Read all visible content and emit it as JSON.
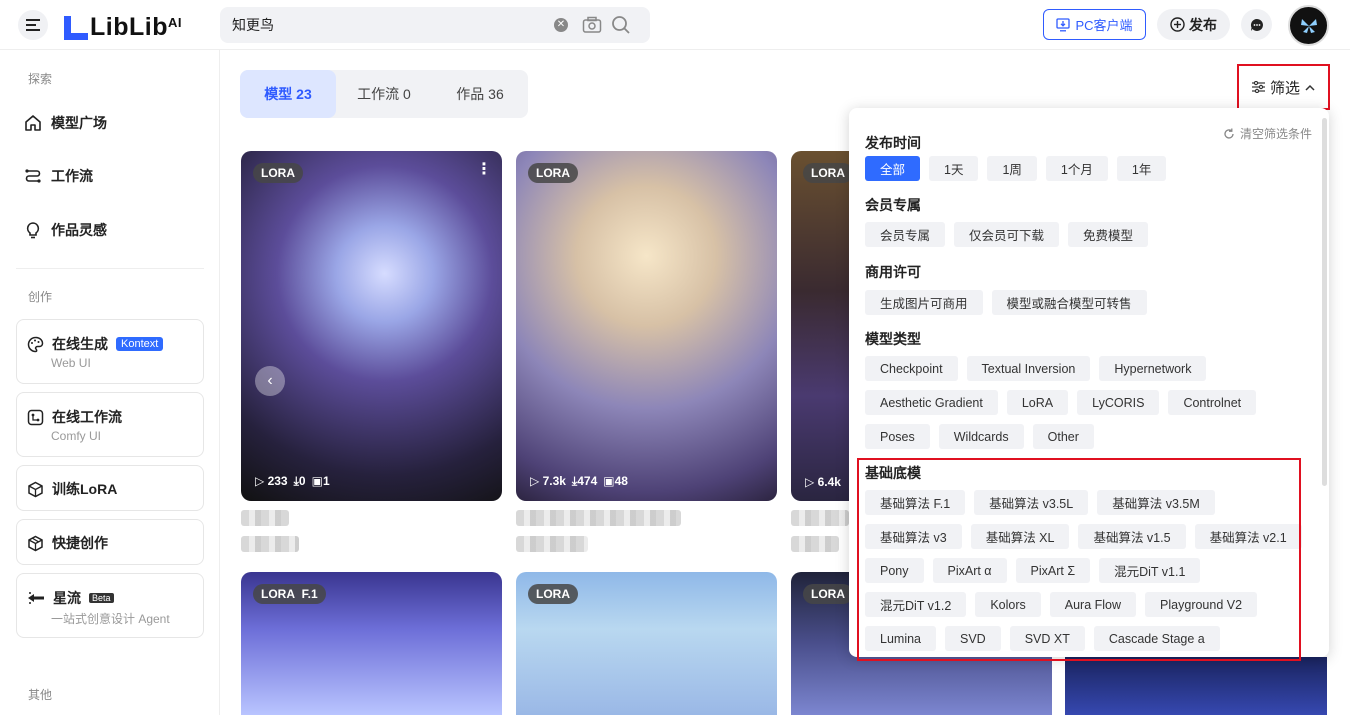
{
  "header": {
    "logo_text": "LibLib",
    "logo_suffix": "AI",
    "search_value": "知更鸟",
    "pc_client": "PC客户端",
    "publish": "发布"
  },
  "sidebar": {
    "explore_label": "探索",
    "explore_items": [
      "模型广场",
      "工作流",
      "作品灵感"
    ],
    "create_label": "创作",
    "online_gen": "在线生成",
    "online_gen_tag": "Kontext",
    "online_gen_sub": "Web UI",
    "online_workflow": "在线工作流",
    "online_workflow_sub": "Comfy UI",
    "train_lora": "训练LoRA",
    "quick_create": "快捷创作",
    "xingliu": "星流",
    "xingliu_tag": "Beta",
    "xingliu_sub": "一站式创意设计 Agent",
    "other_label": "其他"
  },
  "tabs": [
    "模型 23",
    "工作流 0",
    "作品 36"
  ],
  "filter_button": "筛选",
  "cards": [
    {
      "badge": "LORA",
      "plays": "233",
      "downloads": "0",
      "images": "1"
    },
    {
      "badge": "LORA",
      "plays": "7.3k",
      "downloads": "474",
      "images": "48"
    },
    {
      "badge": "LORA",
      "plays": "6.4k"
    },
    {
      "badge": "LORA",
      "badge2": "F.1"
    },
    {
      "badge": "LORA"
    },
    {
      "badge": "LORA"
    }
  ],
  "filter_panel": {
    "clear": "清空筛选条件",
    "sections": [
      {
        "title": "发布时间",
        "rows": [
          [
            "全部",
            "1天",
            "1周",
            "1个月",
            "1年"
          ]
        ]
      },
      {
        "title": "会员专属",
        "rows": [
          [
            "会员专属",
            "仅会员可下载",
            "免费模型"
          ]
        ]
      },
      {
        "title": "商用许可",
        "rows": [
          [
            "生成图片可商用",
            "模型或融合模型可转售"
          ]
        ]
      },
      {
        "title": "模型类型",
        "rows": [
          [
            "Checkpoint",
            "Textual Inversion",
            "Hypernetwork"
          ],
          [
            "Aesthetic Gradient",
            "LoRA",
            "LyCORIS",
            "Controlnet"
          ],
          [
            "Poses",
            "Wildcards",
            "Other"
          ]
        ]
      },
      {
        "title": "基础底模",
        "rows": [
          [
            "基础算法 F.1",
            "基础算法 v3.5L",
            "基础算法 v3.5M"
          ],
          [
            "基础算法 v3",
            "基础算法 XL",
            "基础算法 v1.5",
            "基础算法 v2.1"
          ],
          [
            "Pony",
            "PixArt α",
            "PixArt Σ",
            "混元DiT v1.1"
          ],
          [
            "混元DiT v1.2",
            "Kolors",
            "Aura Flow",
            "Playground V2"
          ],
          [
            "Lumina",
            "SVD",
            "SVD XT",
            "Cascade Stage a"
          ]
        ]
      }
    ]
  }
}
